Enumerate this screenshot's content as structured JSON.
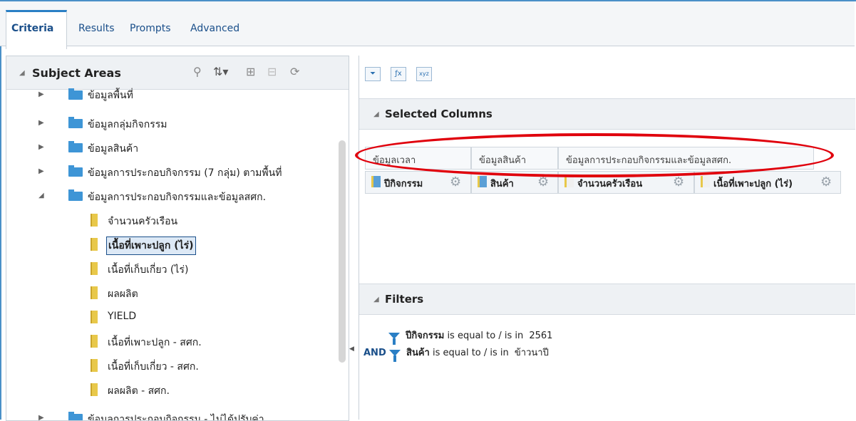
{
  "tabs": [
    {
      "label": "Criteria"
    },
    {
      "label": "Results"
    },
    {
      "label": "Prompts"
    },
    {
      "label": "Advanced"
    }
  ],
  "subject_areas": {
    "title": "Subject Areas",
    "items": [
      {
        "label": "ข้อมูลพื้นที่",
        "type": "folder",
        "state": "collapsed"
      },
      {
        "label": "ข้อมูลกลุ่มกิจกรรม",
        "type": "folder",
        "state": "collapsed"
      },
      {
        "label": "ข้อมูลสินค้า",
        "type": "folder",
        "state": "collapsed"
      },
      {
        "label": "ข้อมูลการประกอบกิจกรรม (7 กลุ่ม) ตามพื้นที่",
        "type": "folder",
        "state": "collapsed"
      },
      {
        "label": "ข้อมูลการประกอบกิจกรรมและข้อมูลสศก.",
        "type": "folder",
        "state": "expanded"
      },
      {
        "label": "จำนวนครัวเรือน",
        "type": "column"
      },
      {
        "label": "เนื้อที่เพาะปลูก (ไร่)",
        "type": "column",
        "selected": true
      },
      {
        "label": "เนื้อที่เก็บเกี่ยว (ไร่)",
        "type": "column"
      },
      {
        "label": "ผลผลิต",
        "type": "column"
      },
      {
        "label": "YIELD",
        "type": "column"
      },
      {
        "label": "เนื้อที่เพาะปลูก - สศก.",
        "type": "column"
      },
      {
        "label": "เนื้อที่เก็บเกี่ยว - สศก.",
        "type": "column"
      },
      {
        "label": "ผลผลิต - สศก.",
        "type": "column"
      },
      {
        "label": "ข้อมูลการประกอบกิจกรรม - ไม่ได้ปรับค่า",
        "type": "folder",
        "state": "collapsed"
      }
    ]
  },
  "toolbar": {
    "xyz_label": "xyz"
  },
  "selected_columns": {
    "title": "Selected Columns",
    "groups": [
      "ข้อมูลเวลา",
      "ข้อมูลสินค้า",
      "ข้อมูลการประกอบกิจกรรมและข้อมูลสศก."
    ],
    "columns": [
      "ปีกิจกรรม",
      "สินค้า",
      "จำนวนครัวเรือน",
      "เนื้อที่เพาะปลูก (ไร่)"
    ]
  },
  "filters": {
    "title": "Filters",
    "items": [
      {
        "prefix": "",
        "column": "ปีกิจกรรม",
        "operator": "is equal to / is in",
        "value": "2561"
      },
      {
        "prefix": "AND",
        "column": "สินค้า",
        "operator": "is equal to / is in",
        "value": "ข้าวนาปี"
      }
    ]
  },
  "annotation": {
    "color": "#e0000c"
  }
}
